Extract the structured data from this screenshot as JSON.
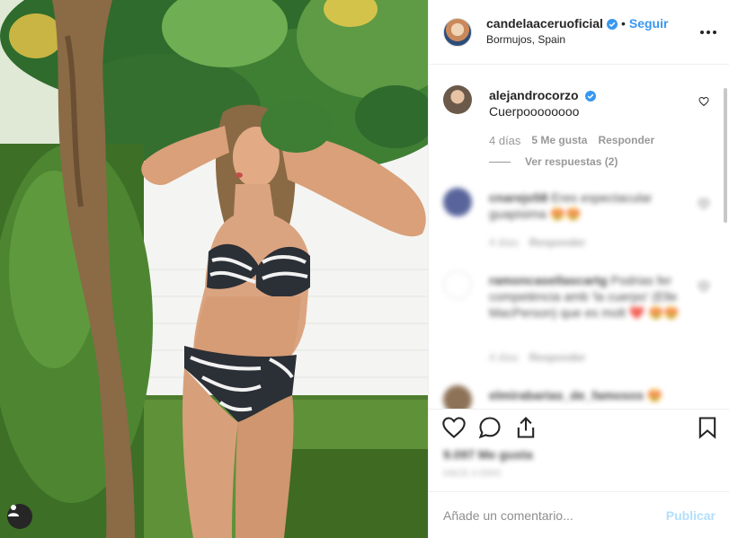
{
  "post": {
    "username": "candelaaceruoficial",
    "separator": "•",
    "follow_label": "Seguir",
    "location": "Bormujos, Spain"
  },
  "comments": [
    {
      "username": "alejandrocorzo",
      "text": "Cuerpoooooooo",
      "time": "4 días",
      "likes": "5 Me gusta",
      "reply_label": "Responder",
      "view_replies": "Ver respuestas (2)"
    },
    {
      "username": "cnarejo58",
      "text": "Eres espectacular guapisima 😍😍",
      "time": "4 días",
      "reply_label": "Responder"
    },
    {
      "username": "ramoncasellascartg",
      "text": "Podrias fer competència amb 'la cuerpo' (Elle MacPerson) que es molt ❤️ 😍😍",
      "time": "4 días",
      "reply_label": "Responder"
    },
    {
      "username": "elmirabarias_de_famosos",
      "text": "😍"
    }
  ],
  "actions": {
    "likes_count": "9.097 Me gusta",
    "time_ago": "HACE 4 DÍAS"
  },
  "composer": {
    "placeholder": "Añade un comentario...",
    "publish_label": "Publicar"
  },
  "colors": {
    "accent": "#3897f0",
    "verified": "#3897f0",
    "muted": "#999999",
    "publish_disabled": "#b2dffc"
  },
  "icons": {
    "like": "heart-icon",
    "comment": "comment-bubble-icon",
    "share": "share-icon",
    "save": "bookmark-icon",
    "more": "more-options-icon",
    "tag": "user-tag-icon"
  }
}
